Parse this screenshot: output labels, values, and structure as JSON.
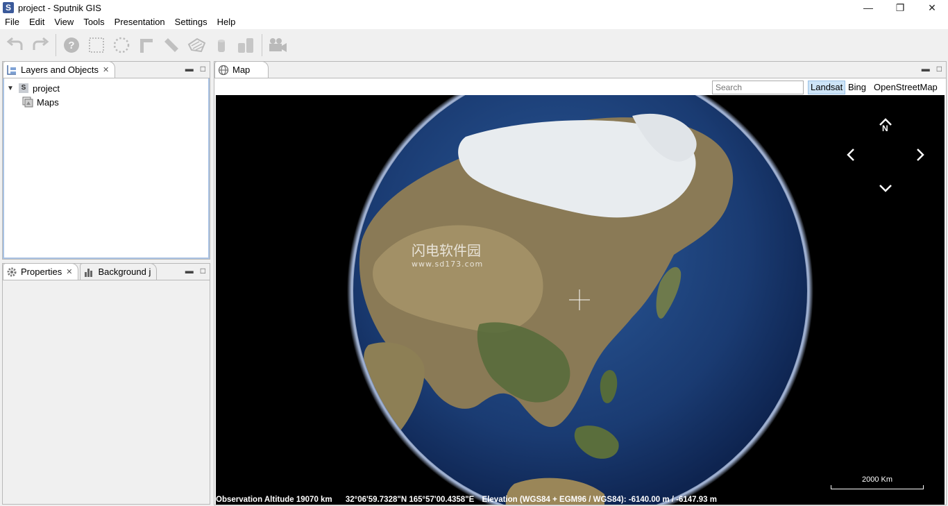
{
  "window": {
    "app_icon_letter": "S",
    "title": "project - Sputnik GIS",
    "controls": {
      "minimize": "—",
      "maximize": "❐",
      "close": "✕"
    }
  },
  "menu": [
    "File",
    "Edit",
    "View",
    "Tools",
    "Presentation",
    "Settings",
    "Help"
  ],
  "toolbar": {
    "icons": [
      "undo-icon",
      "redo-icon",
      "help-icon",
      "select-rectangle-icon",
      "select-lasso-icon",
      "ruler-corner-icon",
      "ruler-icon",
      "polygon-icon",
      "cylinder-icon",
      "bar-chart-icon",
      "video-camera-icon"
    ]
  },
  "layers_panel": {
    "tab_label": "Layers and Objects",
    "tree": [
      {
        "label": "project",
        "icon_letter": "S",
        "expanded": true
      },
      {
        "label": "Maps"
      }
    ]
  },
  "properties_panel": {
    "tabs": [
      "Properties",
      "Background j"
    ]
  },
  "map_panel": {
    "tab_label": "Map",
    "search_placeholder": "Search",
    "sources": [
      "Landsat",
      "Bing",
      "OpenStreetMap"
    ],
    "active_source": "Landsat",
    "nav_north_label": "N",
    "scale_label": "2000 Km",
    "status": {
      "altitude": "Observation Altitude 19070 km",
      "coords": "32°06'59.7328\"N 165°57'00.4358\"E",
      "elevation": "Elevation (WGS84 + EGM96 / WGS84): -6140.00 m / -6147.93 m"
    },
    "watermark_title": "闪电软件园",
    "watermark_url": "www.sd173.com"
  },
  "colors": {
    "accent_selected": "#cde4f7",
    "ocean": "#1d3f7a",
    "land": "#8a7a56",
    "snow": "#e8ecef"
  }
}
